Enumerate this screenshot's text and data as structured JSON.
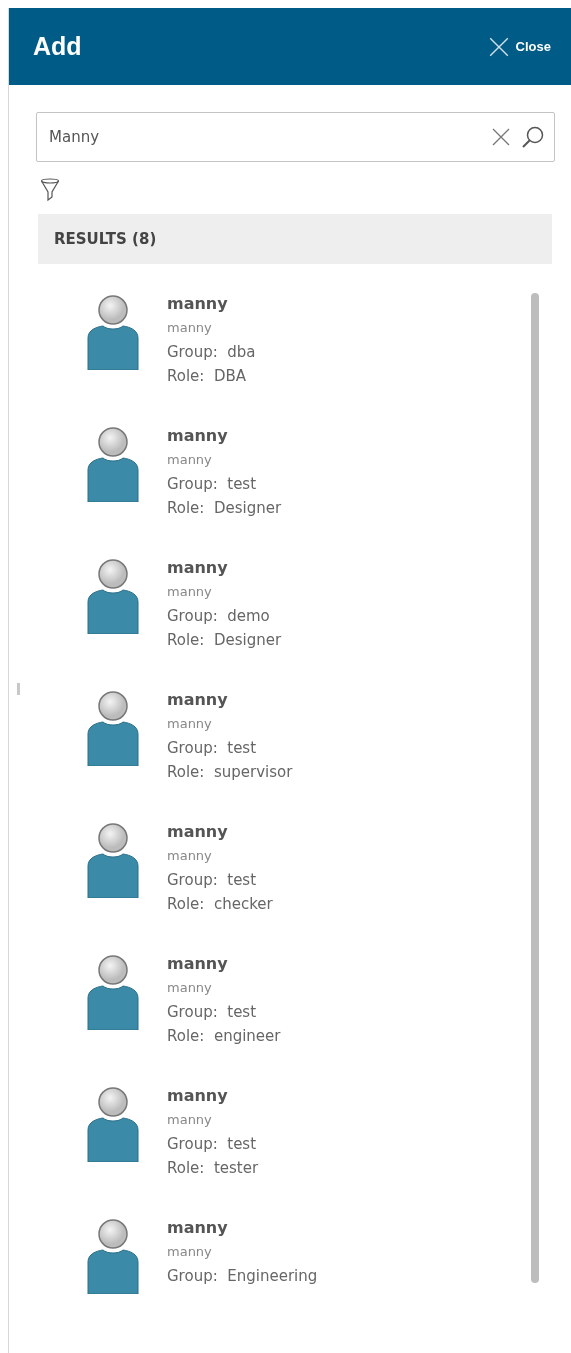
{
  "header": {
    "title": "Add",
    "close_label": "Close"
  },
  "search": {
    "value": "Manny"
  },
  "results": {
    "heading": "RESULTS (8)",
    "items": [
      {
        "name": "manny",
        "username": "manny",
        "group_label": "Group:",
        "group": "dba",
        "role_label": "Role:",
        "role": "DBA"
      },
      {
        "name": "manny",
        "username": "manny",
        "group_label": "Group:",
        "group": "test",
        "role_label": "Role:",
        "role": "Designer"
      },
      {
        "name": "manny",
        "username": "manny",
        "group_label": "Group:",
        "group": "demo",
        "role_label": "Role:",
        "role": "Designer"
      },
      {
        "name": "manny",
        "username": "manny",
        "group_label": "Group:",
        "group": "test",
        "role_label": "Role:",
        "role": "supervisor"
      },
      {
        "name": "manny",
        "username": "manny",
        "group_label": "Group:",
        "group": "test",
        "role_label": "Role:",
        "role": "checker"
      },
      {
        "name": "manny",
        "username": "manny",
        "group_label": "Group:",
        "group": "test",
        "role_label": "Role:",
        "role": "engineer"
      },
      {
        "name": "manny",
        "username": "manny",
        "group_label": "Group:",
        "group": "test",
        "role_label": "Role:",
        "role": "tester"
      },
      {
        "name": "manny",
        "username": "manny",
        "group_label": "Group:",
        "group": "Engineering"
      }
    ]
  }
}
